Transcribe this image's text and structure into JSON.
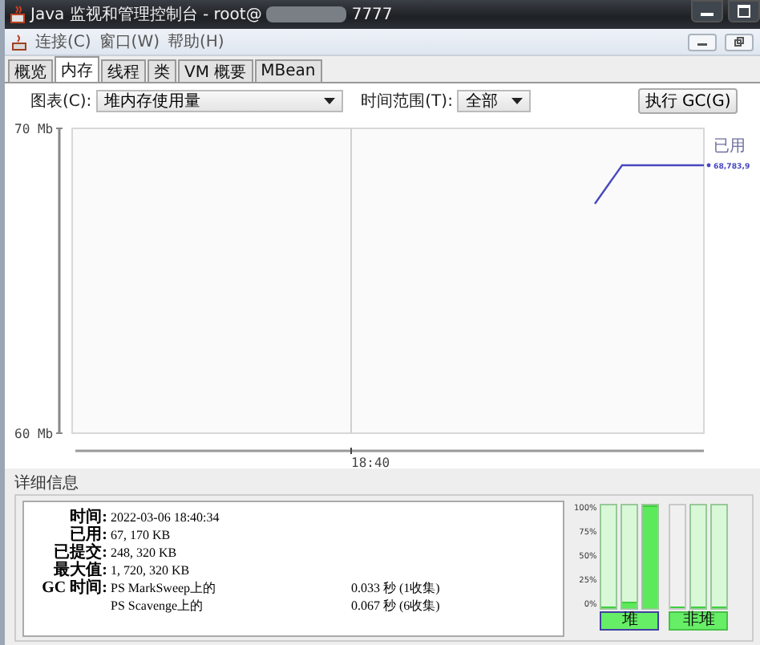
{
  "window": {
    "title": "Java 监视和管理控制台 - root@",
    "title_end": "7777"
  },
  "menu": [
    "连接(C)",
    "窗口(W)",
    "帮助(H)"
  ],
  "tabs": [
    {
      "label": "概览",
      "selected": false
    },
    {
      "label": "内存",
      "selected": true
    },
    {
      "label": "线程",
      "selected": false
    },
    {
      "label": "类",
      "selected": false
    },
    {
      "label": "VM 概要",
      "selected": false
    },
    {
      "label": "MBean",
      "selected": false
    }
  ],
  "toolbar": {
    "chart_label": "图表(C):",
    "chart_value": "堆内存使用量",
    "range_label": "时间范围(T):",
    "range_value": "全部",
    "gc_button": "执行 GC(G)"
  },
  "chart": {
    "y_labels": [
      "70 Mb",
      "60 Mb"
    ],
    "x_label": "18:40",
    "legend_name": "已用",
    "legend_value": "68,783,9"
  },
  "details": {
    "title": "详细信息",
    "rows": [
      {
        "label": "时间:",
        "value": "2022-03-06 18:40:34"
      },
      {
        "label": "已用:",
        "value": "67, 170 KB"
      },
      {
        "label": "已提交:",
        "value": "248, 320 KB"
      },
      {
        "label": "最大值:",
        "value": "1, 720, 320 KB"
      }
    ],
    "gc_label": "GC 时间:",
    "gc": [
      {
        "collector": "PS MarkSweep上的",
        "time": "0.033  秒 (1收集)"
      },
      {
        "collector": "PS Scavenge上的",
        "time": "0.067  秒 (6收集)"
      }
    ]
  },
  "pools": {
    "scale": [
      "100%",
      "75%",
      "50%",
      "25%",
      "0%"
    ],
    "groups": [
      {
        "label": "堆",
        "selected": true,
        "bars": [
          {
            "committed": true,
            "level": 0
          },
          {
            "committed": true,
            "level": 0.07
          },
          {
            "committed": true,
            "level": 1
          }
        ]
      },
      {
        "label": "非堆",
        "selected": false,
        "bars": [
          {
            "committed": false,
            "level": 0
          },
          {
            "committed": true,
            "level": 0.02
          },
          {
            "committed": true,
            "level": 0.01
          }
        ]
      }
    ]
  }
}
